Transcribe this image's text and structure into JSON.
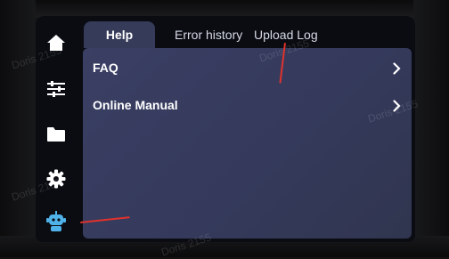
{
  "tabs": [
    {
      "label": "Help",
      "active": true
    },
    {
      "label": "Error history",
      "active": false
    },
    {
      "label": "Upload Log",
      "active": false
    }
  ],
  "sidebar": {
    "items": [
      {
        "icon": "home-icon"
      },
      {
        "icon": "sliders-icon"
      },
      {
        "icon": "folder-icon"
      },
      {
        "icon": "gear-icon"
      },
      {
        "icon": "robot-icon",
        "active": true
      }
    ]
  },
  "help_list": [
    {
      "label": "FAQ"
    },
    {
      "label": "Online Manual"
    }
  ],
  "watermark": "Doris 2155",
  "colors": {
    "panel": "#3a3f63",
    "active_tab": "#353b58",
    "active_icon": "#4fb3ea",
    "annotation_arrow": "#e0322c"
  }
}
